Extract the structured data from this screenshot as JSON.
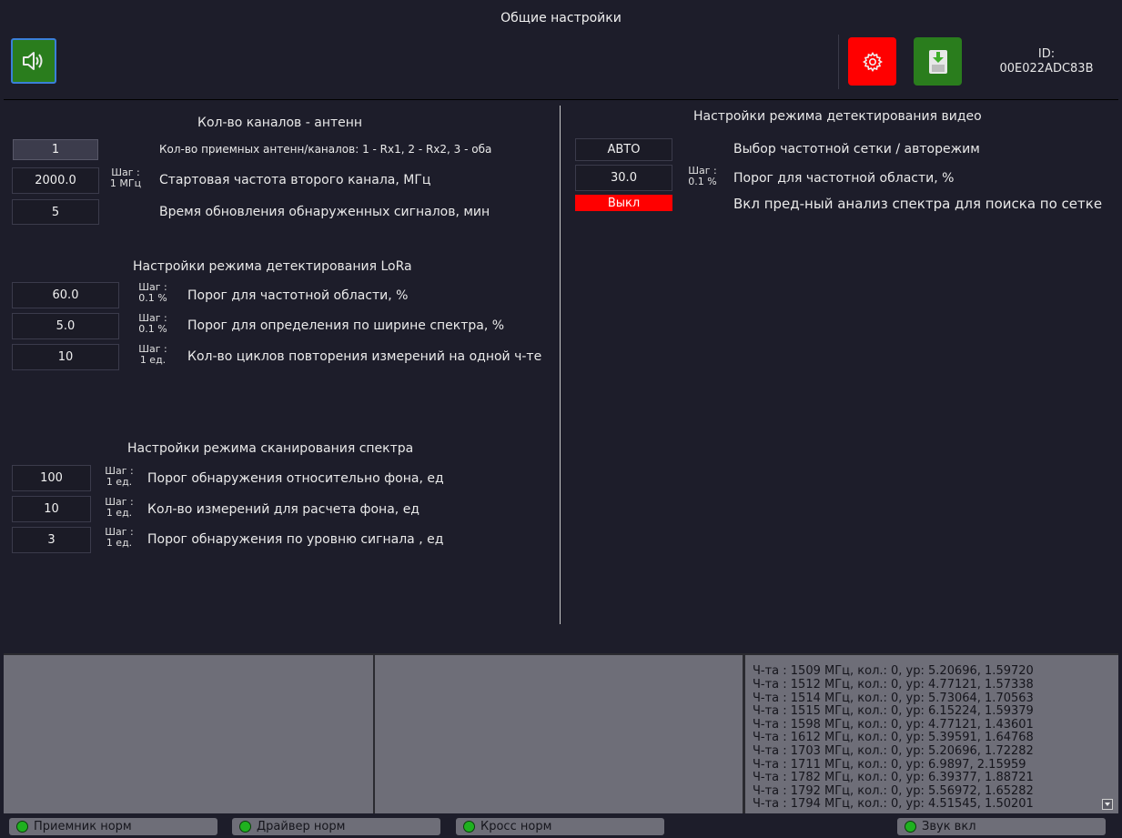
{
  "window": {
    "title": "Общие настройки"
  },
  "toolbar": {
    "sound_icon": "speaker-icon",
    "settings_icon": "gear-icon",
    "save_icon": "save-icon",
    "id_label": "ID:",
    "id_value": "00E022ADC83B",
    "colors": {
      "sound": "#2a7d1d",
      "settings": "#ff0000",
      "save": "#2a7d1d"
    }
  },
  "channels": {
    "title": "Кол-во каналов - антенн",
    "rows": [
      {
        "value": "1",
        "step_top": "",
        "step_bottom": "",
        "label": "Кол-во приемных антенн/каналов: 1 - Rx1, 2 - Rx2, 3 - оба"
      },
      {
        "value": "2000.0",
        "step_top": "Шаг :",
        "step_bottom": "1 МГц",
        "label": "Стартовая частота второго канала, МГц"
      },
      {
        "value": "5",
        "step_top": "",
        "step_bottom": "",
        "label": "Время обновления обнаруженных сигналов, мин"
      }
    ]
  },
  "lora": {
    "title": "Настройки режима детектирования LoRa",
    "rows": [
      {
        "value": "60.0",
        "step_top": "Шаг :",
        "step_bottom": "0.1 %",
        "label": "Порог для частотной области, %"
      },
      {
        "value": "5.0",
        "step_top": "Шаг :",
        "step_bottom": "0.1 %",
        "label": "Порог для определения по ширине спектра, %"
      },
      {
        "value": "10",
        "step_top": "Шаг :",
        "step_bottom": "1 ед.",
        "label": "Кол-во циклов повторения измерений на одной ч-те"
      }
    ]
  },
  "scan": {
    "title": "Настройки режима сканирования спектра",
    "rows": [
      {
        "value": "100",
        "step_top": "Шаг :",
        "step_bottom": "1 ед.",
        "label": "Порог обнаружения  относительно фона, ед"
      },
      {
        "value": "10",
        "step_top": "Шаг :",
        "step_bottom": "1 ед.",
        "label": "Кол-во измерений для расчета фона, ед"
      },
      {
        "value": "3",
        "step_top": "Шаг :",
        "step_bottom": "1 ед.",
        "label": "Порог обнаружения по уровню сигнала , ед"
      }
    ]
  },
  "video": {
    "title": "Настройки режима детектирования видео",
    "rows": [
      {
        "value": "АВТО",
        "step_top": "",
        "step_bottom": "",
        "label": "Выбор частотной сетки / авторежим"
      },
      {
        "value": "30.0",
        "step_top": "Шаг :",
        "step_bottom": "0.1 %",
        "label": "Порог для частотной области, %"
      },
      {
        "value": "Выкл",
        "step_top": "",
        "step_bottom": "",
        "label": "Вкл пред-ный анализ спектра для поиска по сетке"
      }
    ]
  },
  "log": {
    "lines": [
      "Ч-та : 1509 МГц, кол.: 0, ур: 5.20696, 1.59720",
      "Ч-та : 1512 МГц, кол.: 0, ур: 4.77121, 1.57338",
      "Ч-та : 1514 МГц, кол.: 0, ур: 5.73064, 1.70563",
      "Ч-та : 1515 МГц, кол.: 0, ур: 6.15224, 1.59379",
      "Ч-та : 1598 МГц, кол.: 0, ур: 4.77121, 1.43601",
      "Ч-та : 1612 МГц, кол.: 0, ур: 5.39591, 1.64768",
      "Ч-та : 1703 МГц, кол.: 0, ур: 5.20696, 1.72282",
      "Ч-та : 1711 МГц, кол.: 0, ур: 6.9897, 2.15959",
      "Ч-та : 1782 МГц, кол.: 0, ур: 6.39377, 1.88721",
      "Ч-та : 1792 МГц, кол.: 0, ур: 5.56972, 1.65282",
      "Ч-та : 1794 МГц, кол.: 0, ур: 4.51545, 1.50201"
    ]
  },
  "status_bar": {
    "items": [
      {
        "label": "Приемник норм",
        "color": "#1fb11f"
      },
      {
        "label": "Драйвер норм",
        "color": "#1fb11f"
      },
      {
        "label": "Кросс норм",
        "color": "#1fb11f"
      },
      {
        "label": "Звук вкл",
        "color": "#1fb11f"
      }
    ]
  }
}
